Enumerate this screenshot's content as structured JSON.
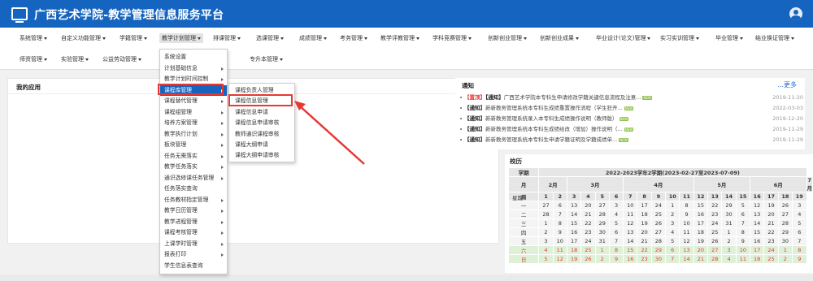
{
  "header": {
    "title": "广西艺术学院-教学管理信息服务平台"
  },
  "nav": {
    "row1": [
      "系统管理",
      "自定义功能管理",
      "学籍管理",
      "教学计划管理",
      "排课管理",
      "选课管理",
      "成绩管理",
      "考务管理",
      "教学评教管理",
      "学科竞赛管理",
      "创新创业管理",
      "创新创业成果",
      "毕业设计(论文)管理",
      "实习实训管理",
      "毕业管理",
      "结业换证管理"
    ],
    "row2": [
      "师资管理",
      "实验管理",
      "公益劳动管理",
      "",
      "专升本管理"
    ]
  },
  "my_apps": {
    "title": "我的应用"
  },
  "notice": {
    "title": "通知",
    "more": "...更多",
    "items": [
      {
        "tag1": "【置顶】",
        "tag2": "【通知】",
        "text": "广西艺术学院本专科生申请修改学籍关键信息流程及注意...",
        "date": "2019-11-20"
      },
      {
        "tag1": "",
        "tag2": "【通知】",
        "text": "新新教务管理系统本专科生成绩重置操作流程（学生狂开...",
        "date": "2022-03-03"
      },
      {
        "tag1": "",
        "tag2": "【通知】",
        "text": "新新教务管理系统录入本专科生成绩操作说明（教师版）",
        "date": "2019-12-20"
      },
      {
        "tag1": "",
        "tag2": "【通知】",
        "text": "新新教务管理系统本专科生成绩给改（增加）操作说明（...",
        "date": "2019-11-29"
      },
      {
        "tag1": "",
        "tag2": "【通知】",
        "text": "新新教务管理系统本专科生申请学籍证明及学籍成绩单...",
        "date": "2019-11-29"
      }
    ]
  },
  "calendar": {
    "title": "校历",
    "semester": "2022-2023学年2学期(2023-02-27至2023-07-09)",
    "corner": [
      "学期",
      "月",
      "周",
      "星期"
    ],
    "months": [
      {
        "label": "2月",
        "span": 2
      },
      {
        "label": "3月",
        "span": 4
      },
      {
        "label": "4月",
        "span": 5
      },
      {
        "label": "5月",
        "span": 4
      },
      {
        "label": "6月",
        "span": 4
      },
      {
        "label": "7月",
        "span": 2
      }
    ],
    "weeks": [
      "1",
      "2",
      "3",
      "4",
      "5",
      "6",
      "7",
      "8",
      "9",
      "10",
      "11",
      "12",
      "13",
      "14",
      "15",
      "16",
      "17",
      "18",
      "19"
    ],
    "rows": [
      {
        "day": "一",
        "cells": [
          "27",
          "6",
          "13",
          "20",
          "27",
          "3",
          "10",
          "17",
          "24",
          "1",
          "8",
          "15",
          "22",
          "29",
          "5",
          "12",
          "19",
          "26",
          "3"
        ]
      },
      {
        "day": "二",
        "cells": [
          "28",
          "7",
          "14",
          "21",
          "28",
          "4",
          "11",
          "18",
          "25",
          "2",
          "9",
          "16",
          "23",
          "30",
          "6",
          "13",
          "20",
          "27",
          "4"
        ]
      },
      {
        "day": "三",
        "cells": [
          "1",
          "8",
          "15",
          "22",
          "29",
          "5",
          "12",
          "19",
          "26",
          "3",
          "10",
          "17",
          "24",
          "31",
          "7",
          "14",
          "21",
          "28",
          "5"
        ]
      },
      {
        "day": "四",
        "cells": [
          "2",
          "9",
          "16",
          "23",
          "30",
          "6",
          "13",
          "20",
          "27",
          "4",
          "11",
          "18",
          "25",
          "1",
          "8",
          "15",
          "22",
          "29",
          "6"
        ]
      },
      {
        "day": "五",
        "cells": [
          "3",
          "10",
          "17",
          "24",
          "31",
          "7",
          "14",
          "21",
          "28",
          "5",
          "12",
          "19",
          "26",
          "2",
          "9",
          "16",
          "23",
          "30",
          "7"
        ]
      },
      {
        "day": "六",
        "cells": [
          "4",
          "11",
          "18",
          "25",
          "1",
          "8",
          "15",
          "22",
          "29",
          "6",
          "13",
          "20",
          "27",
          "3",
          "10",
          "17",
          "24",
          "1",
          "8"
        ]
      },
      {
        "day": "日",
        "cells": [
          "5",
          "12",
          "19",
          "26",
          "2",
          "9",
          "16",
          "23",
          "30",
          "7",
          "14",
          "21",
          "28",
          "4",
          "11",
          "18",
          "25",
          "2",
          "9"
        ]
      }
    ]
  },
  "menu1": [
    "系统设置",
    "计划基础信息",
    "教学计划时间控制",
    "课程库管理",
    "课程替代管理",
    "课程组管理",
    "培养方案管理",
    "教学执行计划",
    "板块管理",
    "任务无需落实",
    "教学任务落实",
    "通识选修课任务管理",
    "任务落实查询",
    "任务教材指定管理",
    "教学日历管理",
    "教学进程管理",
    "课程考核管理",
    "上课学时管理",
    "报表打印",
    "学生信息表查询"
  ],
  "menu1_arrows": [
    false,
    true,
    true,
    true,
    true,
    true,
    true,
    true,
    true,
    true,
    true,
    true,
    false,
    true,
    true,
    true,
    true,
    true,
    true,
    false
  ],
  "menu2": [
    "课程负责人管理",
    "课程信息管理",
    "课程信息申请",
    "课程信息申请审核",
    "教师通识课程审核",
    "课程大纲申请",
    "课程大纲申请审核"
  ],
  "colors": {
    "brand": "#1565c0",
    "highlight": "#e53935",
    "weekend_bg": "#dff0d8"
  }
}
